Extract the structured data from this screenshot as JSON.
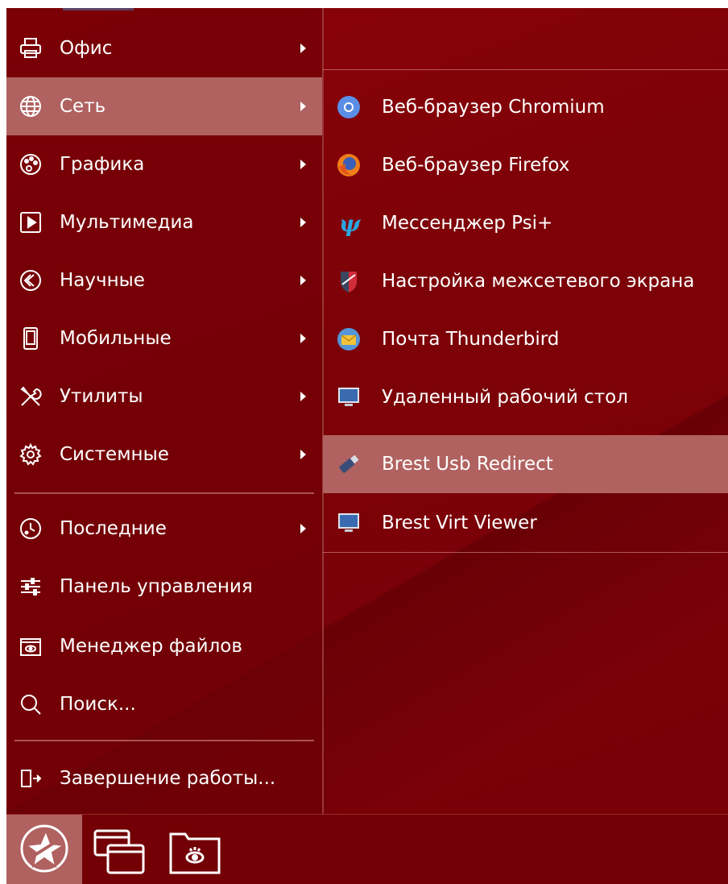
{
  "main_menu": {
    "items": [
      {
        "label": "Офис",
        "icon": "printer-icon",
        "has_submenu": true
      },
      {
        "label": "Сеть",
        "icon": "globe-icon",
        "has_submenu": true,
        "selected": true
      },
      {
        "label": "Графика",
        "icon": "palette-icon",
        "has_submenu": true
      },
      {
        "label": "Мультимедиа",
        "icon": "play-icon",
        "has_submenu": true
      },
      {
        "label": "Научные",
        "icon": "science-icon",
        "has_submenu": true
      },
      {
        "label": "Мобильные",
        "icon": "phone-icon",
        "has_submenu": true
      },
      {
        "label": "Утилиты",
        "icon": "tools-icon",
        "has_submenu": true
      },
      {
        "label": "Системные",
        "icon": "gear-icon",
        "has_submenu": true
      },
      {
        "label": "Последние",
        "icon": "recent-icon",
        "has_submenu": true
      },
      {
        "label": "Панель управления",
        "icon": "sliders-icon",
        "has_submenu": false
      },
      {
        "label": "Менеджер файлов",
        "icon": "file-manager-icon",
        "has_submenu": false
      },
      {
        "label": "Поиск...",
        "icon": "search-icon",
        "has_submenu": false
      },
      {
        "label": "Завершение работы...",
        "icon": "logout-icon",
        "has_submenu": false
      }
    ]
  },
  "submenu": {
    "items": [
      {
        "label": "Веб-браузер Chromium",
        "icon": "chromium-icon"
      },
      {
        "label": "Веб-браузер Firefox",
        "icon": "firefox-icon"
      },
      {
        "label": "Мессенджер Psi+",
        "icon": "psi-icon"
      },
      {
        "label": "Настройка межсетевого экрана",
        "icon": "firewall-shield-icon"
      },
      {
        "label": "Почта Thunderbird",
        "icon": "thunderbird-icon"
      },
      {
        "label": "Удаленный рабочий стол",
        "icon": "monitor-icon"
      },
      {
        "label": "Brest Usb Redirect",
        "icon": "usb-icon",
        "selected": true
      },
      {
        "label": "Brest Virt Viewer",
        "icon": "monitor-icon"
      }
    ]
  },
  "taskbar": {
    "start_icon": "star-logo-icon",
    "items": [
      {
        "icon": "windows-icon"
      },
      {
        "icon": "file-manager-icon"
      }
    ]
  },
  "colors": {
    "background": "#7e0208",
    "highlight": "#b06260",
    "text": "#ffffff"
  }
}
